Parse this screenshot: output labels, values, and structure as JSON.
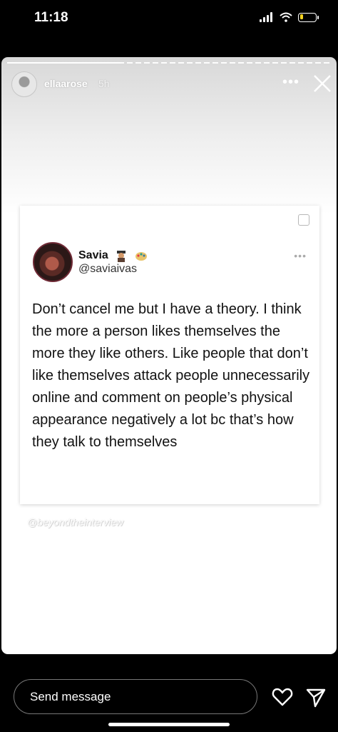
{
  "status_bar": {
    "time": "11:18",
    "signal_icon": "cellular-signal-icon",
    "wifi_icon": "wifi-icon",
    "battery_icon": "battery-icon",
    "battery_level": 0.22,
    "battery_color": "#f5d21f"
  },
  "story": {
    "username": "ellaarose",
    "timestamp": "5h",
    "more_icon": "more-options-icon",
    "close_icon": "close-icon",
    "progress": 0.35
  },
  "tweet": {
    "name": "Savia",
    "badges": [
      "emoji-icon",
      "emoji-icon"
    ],
    "handle": "@saviaivas",
    "text": "Don’t cancel me but I have a theory. I think the more a person likes themselves the more they like others. Like people that don’t like themselves attack people unnecessarily online and comment on people’s physical appearance negatively a lot  bc that’s how they talk to themselves"
  },
  "watermark": "@beyondtheinterview",
  "footer": {
    "placeholder": "Send message",
    "like_icon": "heart-icon",
    "share_icon": "send-icon"
  }
}
